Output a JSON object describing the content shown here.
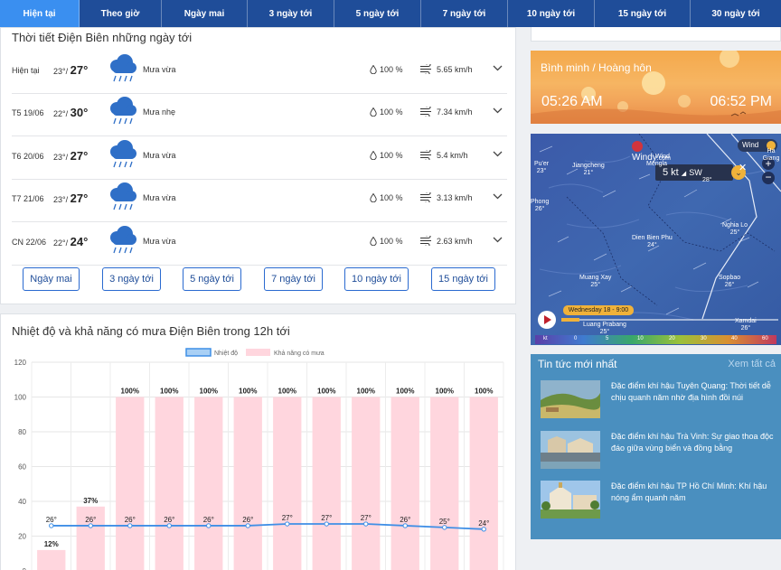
{
  "tabs": [
    {
      "label": "Hiện tại",
      "active": true
    },
    {
      "label": "Theo giờ",
      "active": false
    },
    {
      "label": "Ngày mai",
      "active": false
    },
    {
      "label": "3 ngày tới",
      "active": false
    },
    {
      "label": "5 ngày tới",
      "active": false
    },
    {
      "label": "7 ngày tới",
      "active": false
    },
    {
      "label": "10 ngày tới",
      "active": false
    },
    {
      "label": "15 ngày tới",
      "active": false
    },
    {
      "label": "30 ngày tới",
      "active": false
    }
  ],
  "forecast": {
    "title": "Thời tiết Điện Biên những ngày tới",
    "rows": [
      {
        "day": "Hiện tại",
        "low": "23°/",
        "high": "27°",
        "desc": "Mưa vừa",
        "humidity": "100 %",
        "wind": "5.65 km/h",
        "icon": "rain-cloud-icon"
      },
      {
        "day": "T5 19/06",
        "low": "22°/",
        "high": "30°",
        "desc": "Mưa nhẹ",
        "humidity": "100 %",
        "wind": "7.34 km/h",
        "icon": "rain-cloud-icon"
      },
      {
        "day": "T6 20/06",
        "low": "23°/",
        "high": "27°",
        "desc": "Mưa vừa",
        "humidity": "100 %",
        "wind": "5.4 km/h",
        "icon": "rain-cloud-icon"
      },
      {
        "day": "T7 21/06",
        "low": "23°/",
        "high": "27°",
        "desc": "Mưa vừa",
        "humidity": "100 %",
        "wind": "3.13 km/h",
        "icon": "rain-cloud-icon"
      },
      {
        "day": "CN 22/06",
        "low": "22°/",
        "high": "24°",
        "desc": "Mưa vừa",
        "humidity": "100 %",
        "wind": "2.63 km/h",
        "icon": "rain-cloud-icon"
      }
    ],
    "buttons": [
      "Ngày mai",
      "3 ngày tới",
      "5 ngày tới",
      "7 ngày tới",
      "10 ngày tới",
      "15 ngày tới"
    ]
  },
  "hourly_title": "Nhiệt độ và khả năng có mưa Điện Biên trong 12h tới",
  "chart_data": {
    "type": "bar",
    "legend": [
      "Nhiệt độ",
      "Khả năng có mưa"
    ],
    "legend_position": "top-center",
    "yticks": [
      0,
      20,
      40,
      60,
      80,
      100,
      120
    ],
    "ylim": [
      0,
      120
    ],
    "grid": true,
    "series": [
      {
        "name": "Khả năng có mưa",
        "type": "bar",
        "color": "#ffd6de",
        "values": [
          12,
          37,
          100,
          100,
          100,
          100,
          100,
          100,
          100,
          100,
          100,
          100
        ],
        "labels": [
          "12%",
          "37%",
          "100%",
          "100%",
          "100%",
          "100%",
          "100%",
          "100%",
          "100%",
          "100%",
          "100%",
          "100%"
        ]
      },
      {
        "name": "Nhiệt độ",
        "type": "line",
        "color": "#3f8fe6",
        "values": [
          26,
          26,
          26,
          26,
          26,
          26,
          27,
          27,
          27,
          26,
          25,
          24
        ],
        "labels": [
          "26°",
          "26°",
          "26°",
          "26°",
          "26°",
          "26°",
          "27°",
          "27°",
          "27°",
          "26°",
          "25°",
          "24°"
        ]
      }
    ]
  },
  "sun": {
    "title": "Bình minh / Hoàng hôn",
    "sunrise": "05:26 AM",
    "sunset": "06:52 PM"
  },
  "map": {
    "brand": "Windy",
    "brand_suffix": ".com",
    "wind_badge": "Wind",
    "speed": "5 kt",
    "direction": "SW",
    "timeline": "Wednesday 18 - 9:00",
    "scale_unit": "kt",
    "scale": [
      "0",
      "5",
      "10",
      "20",
      "30",
      "40",
      "60"
    ],
    "places": [
      {
        "name": "Pu'er",
        "temp": "23°"
      },
      {
        "name": "Jiangcheng",
        "temp": "21°"
      },
      {
        "name": "Wind",
        "temp": ""
      },
      {
        "name": "Mengla",
        "temp": ""
      },
      {
        "name": "Ha Giang",
        "temp": ""
      },
      {
        "name": "28°",
        "temp": ""
      },
      {
        "name": "Phong",
        "temp": "26°"
      },
      {
        "name": "Nghia Lo",
        "temp": "25°"
      },
      {
        "name": "Dien Bien Phu",
        "temp": "24°"
      },
      {
        "name": "Muang Xay",
        "temp": "25°"
      },
      {
        "name": "Sopbao",
        "temp": "26°"
      },
      {
        "name": "Luang Prabang",
        "temp": "25°"
      },
      {
        "name": "Xamdai",
        "temp": "26°"
      }
    ]
  },
  "news": {
    "title": "Tin tức mới nhất",
    "see_all": "Xem tất cả",
    "items": [
      {
        "title": "Đặc điểm khí hậu Tuyên Quang: Thời tiết dễ chịu quanh năm nhờ địa hình đồi núi"
      },
      {
        "title": "Đặc điểm khí hậu Trà Vinh: Sự giao thoa độc đáo giữa vùng biển và đồng bằng"
      },
      {
        "title": "Đặc điểm khí hậu TP Hồ Chí Minh: Khí hậu nóng ẩm quanh năm"
      }
    ]
  }
}
